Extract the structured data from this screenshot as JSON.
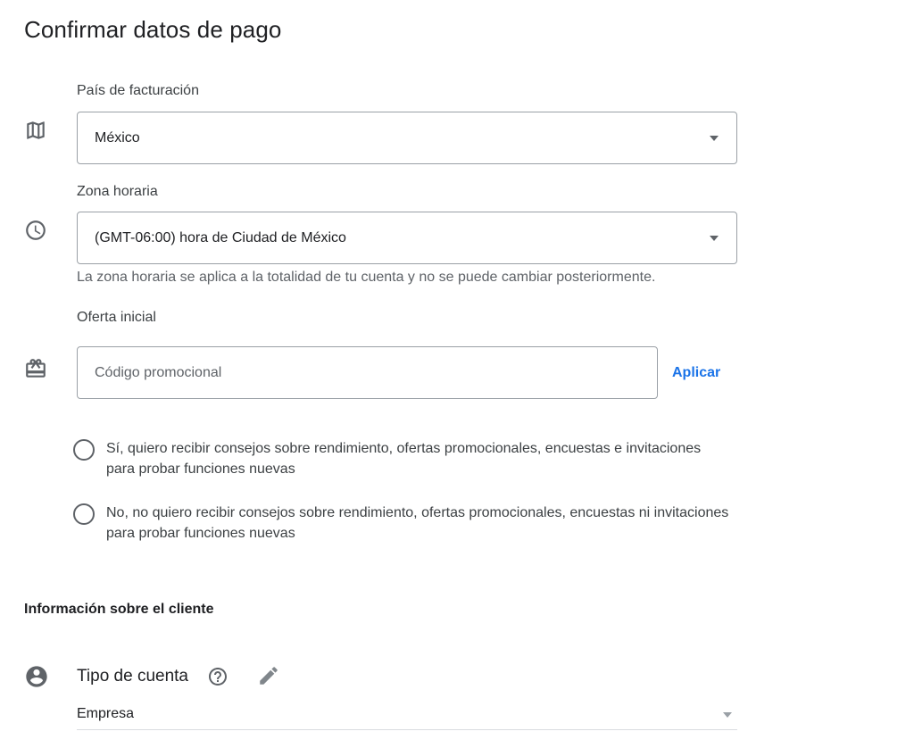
{
  "page": {
    "title": "Confirmar datos de pago"
  },
  "billing_country": {
    "label": "País de facturación",
    "value": "México",
    "icon": "map-icon"
  },
  "time_zone": {
    "label": "Zona horaria",
    "value": "(GMT-06:00) hora de Ciudad de México",
    "helper": "La zona horaria se aplica a la totalidad de tu cuenta y no se puede cambiar posteriormente.",
    "icon": "clock-icon"
  },
  "initial_offer": {
    "label": "Oferta inicial",
    "placeholder": "Código promocional",
    "value": "",
    "apply_label": "Aplicar",
    "icon": "gift-icon"
  },
  "communications": {
    "options": [
      {
        "label": "Sí, quiero recibir consejos sobre rendimiento, ofertas promocionales, encuestas e invitaciones para probar funciones nuevas",
        "selected": false
      },
      {
        "label": "No, no quiero recibir consejos sobre rendimiento, ofertas promocionales, encuestas ni invitaciones para probar funciones nuevas",
        "selected": false
      }
    ]
  },
  "customer_info": {
    "title": "Información sobre el cliente",
    "account_type_label": "Tipo de cuenta",
    "account_type_value": "Empresa",
    "icons": [
      "account-circle-icon",
      "help-circle-icon",
      "pencil-icon"
    ]
  },
  "colors": {
    "accent": "#1a73e8",
    "text": "#202124",
    "secondary_text": "#5f6368",
    "border": "#9aa0a6"
  }
}
